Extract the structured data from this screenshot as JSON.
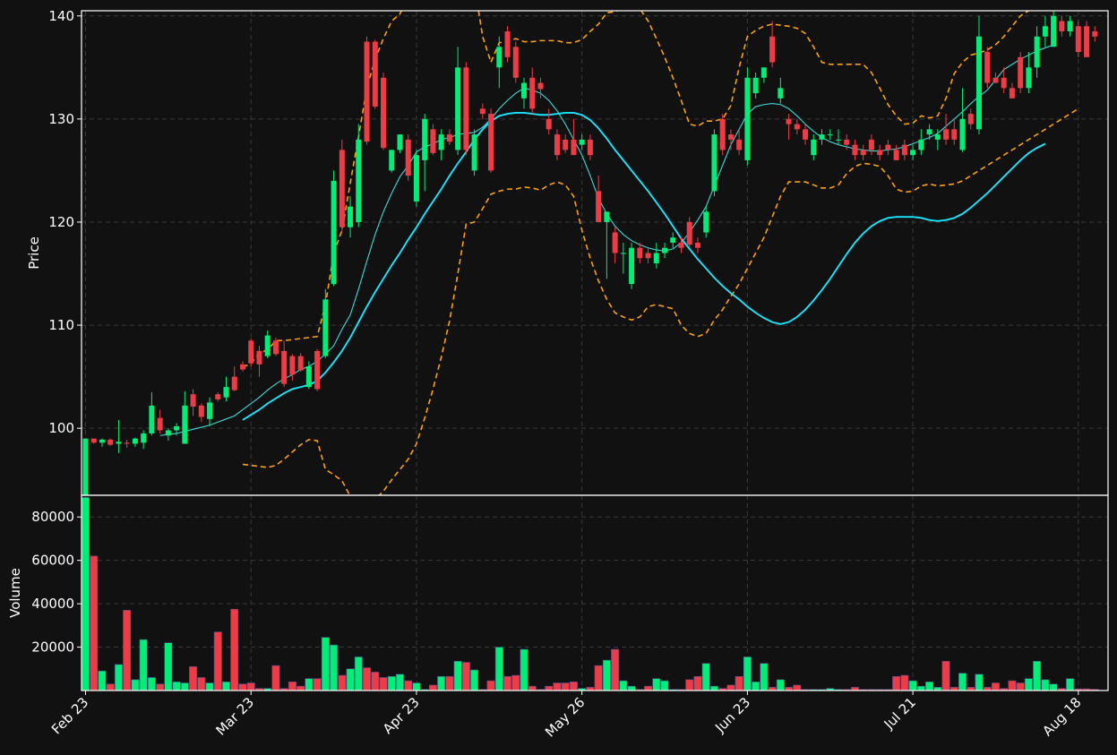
{
  "chart_data": {
    "type": "candlestick",
    "colors": {
      "background": "#111111",
      "up": "#00ee77",
      "down": "#ee3c46",
      "mav_short": "#40d8d8",
      "mav_long": "#18e6ff",
      "bands": "#ffa010",
      "grid": "#3a3a3a",
      "frame": "#ffffff"
    },
    "price_panel": {
      "ylabel": "Price",
      "ylim": [
        93.5,
        140.5
      ],
      "yticks": [
        100,
        110,
        120,
        130,
        140
      ]
    },
    "volume_panel": {
      "ylabel": "Volume",
      "ylim": [
        0,
        90000
      ],
      "yticks": [
        20000,
        40000,
        60000,
        80000
      ]
    },
    "x_ticks": [
      {
        "index": 0,
        "label": "Feb 23"
      },
      {
        "index": 20,
        "label": "Mar 23"
      },
      {
        "index": 40,
        "label": "Apr 23"
      },
      {
        "index": 60,
        "label": "May 26"
      },
      {
        "index": 80,
        "label": "Jun 23"
      },
      {
        "index": 100,
        "label": "Jul 21"
      },
      {
        "index": 120,
        "label": "Aug 18"
      }
    ],
    "candles": [
      [
        93.5,
        99,
        93.5,
        99,
        89000
      ],
      [
        99,
        99,
        98.5,
        98.6,
        62000
      ],
      [
        98.6,
        99,
        98.2,
        98.9,
        9000
      ],
      [
        98.9,
        99,
        98.3,
        98.4,
        3000
      ],
      [
        98.5,
        100.8,
        97.6,
        98.7,
        12000
      ],
      [
        98.6,
        98.9,
        98.1,
        98.5,
        37000
      ],
      [
        98.5,
        99.1,
        98.2,
        99.0,
        5000
      ],
      [
        98.6,
        99.8,
        98.0,
        99.5,
        23500
      ],
      [
        99.5,
        103.5,
        99.3,
        102.2,
        6000
      ],
      [
        101.0,
        101.8,
        99.5,
        99.8,
        3000
      ],
      [
        99.3,
        100.0,
        98.8,
        99.8,
        22000
      ],
      [
        99.8,
        100.5,
        99.3,
        100.2,
        4000
      ],
      [
        98.5,
        103.6,
        98.5,
        102.2,
        3500
      ],
      [
        103.3,
        103.8,
        101.2,
        102.1,
        11000
      ],
      [
        102.2,
        102.4,
        100.6,
        101.1,
        6000
      ],
      [
        100.9,
        103.0,
        100.2,
        102.5,
        3500
      ],
      [
        103.3,
        103.5,
        102.6,
        102.8,
        27000
      ],
      [
        103.0,
        105.0,
        102.6,
        104.0,
        4000
      ],
      [
        105.0,
        106.0,
        103.6,
        103.7,
        37500
      ],
      [
        106.2,
        106.5,
        105.5,
        105.7,
        3000
      ],
      [
        108.5,
        108.7,
        106.0,
        106.3,
        3500
      ],
      [
        107.5,
        108.0,
        105.0,
        106.2,
        1000
      ],
      [
        107.0,
        109.5,
        106.8,
        109.0,
        1000
      ],
      [
        108.5,
        108.8,
        107.0,
        107.2,
        11500
      ],
      [
        107.5,
        108.5,
        104.0,
        104.3,
        1000
      ],
      [
        107.0,
        107.2,
        104.6,
        105.2,
        4000
      ],
      [
        107.0,
        107.3,
        105.5,
        105.6,
        2000
      ],
      [
        104.0,
        106.5,
        103.8,
        106.0,
        5500
      ],
      [
        107.5,
        107.7,
        103.6,
        103.8,
        5500
      ],
      [
        107.0,
        113.5,
        106.8,
        112.5,
        24500
      ],
      [
        114.0,
        125.0,
        113.8,
        124.0,
        21000
      ],
      [
        127.0,
        128.0,
        119.0,
        119.5,
        7000
      ],
      [
        119.5,
        122.5,
        118.5,
        121.5,
        10000
      ],
      [
        120.0,
        129.5,
        119.5,
        128.0,
        15500
      ],
      [
        137.5,
        138.0,
        127.5,
        127.8,
        10500
      ],
      [
        137.5,
        137.7,
        131.0,
        131.2,
        8500
      ],
      [
        134.0,
        134.5,
        127.0,
        127.2,
        6000
      ],
      [
        125.0,
        127.0,
        124.8,
        127.0,
        6500
      ],
      [
        127.0,
        128.0,
        126.7,
        128.5,
        7500
      ],
      [
        128.0,
        128.5,
        124.0,
        124.5,
        4500
      ],
      [
        122.0,
        127.0,
        121.5,
        126.5,
        3500
      ],
      [
        126.0,
        130.5,
        123.0,
        130.0,
        500
      ],
      [
        129.0,
        129.5,
        126.5,
        126.7,
        2500
      ],
      [
        127.0,
        129.0,
        126.0,
        128.5,
        6500
      ],
      [
        128.5,
        129.0,
        127.5,
        127.8,
        6500
      ],
      [
        127.0,
        137.0,
        126.5,
        135.0,
        13500
      ],
      [
        135.0,
        135.5,
        126.5,
        127.0,
        13000
      ],
      [
        125.0,
        129.0,
        124.5,
        128.5,
        9500
      ],
      [
        131.0,
        131.5,
        130.0,
        130.5,
        500
      ],
      [
        130.5,
        131.0,
        124.8,
        125.0,
        4500
      ],
      [
        135.0,
        138.0,
        133.0,
        137.0,
        20000
      ],
      [
        138.5,
        139.0,
        135.5,
        136.0,
        6500
      ],
      [
        137.0,
        137.5,
        133.5,
        134.0,
        7000
      ],
      [
        132.0,
        134.0,
        131.0,
        133.5,
        19000
      ],
      [
        134.0,
        135.0,
        130.5,
        131.0,
        2000
      ],
      [
        133.5,
        134.0,
        132.0,
        132.9,
        500
      ],
      [
        130.0,
        131.0,
        128.5,
        129.0,
        2000
      ],
      [
        128.5,
        129.0,
        126.0,
        126.5,
        3500
      ],
      [
        128.0,
        128.5,
        126.7,
        127.0,
        3500
      ],
      [
        128.0,
        130.0,
        126.5,
        126.5,
        4000
      ],
      [
        127.5,
        128.5,
        127.0,
        128.0,
        1000
      ],
      [
        128.0,
        128.5,
        126.0,
        126.5,
        1500
      ],
      [
        123.0,
        124.5,
        120.0,
        120.0,
        11500
      ],
      [
        120.0,
        121.0,
        114.5,
        121.0,
        14000
      ],
      [
        119.0,
        119.5,
        116.0,
        117.0,
        19000
      ],
      [
        117.0,
        118.0,
        115.0,
        117.0,
        4500
      ],
      [
        114.0,
        118.0,
        113.5,
        117.5,
        2000
      ],
      [
        117.5,
        118.0,
        116.0,
        116.5,
        500
      ],
      [
        117.0,
        117.5,
        116.0,
        116.5,
        2000
      ],
      [
        116.0,
        118.0,
        115.5,
        117.0,
        5500
      ],
      [
        117.0,
        118.0,
        116.5,
        117.5,
        4500
      ],
      [
        118.0,
        119.0,
        117.5,
        118.5,
        500
      ],
      [
        118.0,
        118.5,
        117.0,
        117.5,
        500
      ],
      [
        120.0,
        120.5,
        117.5,
        117.8,
        5000
      ],
      [
        118.0,
        118.5,
        117.0,
        117.5,
        6500
      ],
      [
        119.0,
        121.5,
        118.5,
        121.0,
        12500
      ],
      [
        123.0,
        129.0,
        122.5,
        128.5,
        2000
      ],
      [
        130.0,
        130.5,
        126.5,
        127.0,
        1000
      ],
      [
        128.5,
        129.0,
        127.0,
        128.0,
        2500
      ],
      [
        128.0,
        129.0,
        126.5,
        127.0,
        6500
      ],
      [
        126.0,
        135.0,
        125.5,
        134.0,
        15500
      ],
      [
        132.5,
        134.5,
        132.0,
        134.0,
        4000
      ],
      [
        134.0,
        135.0,
        133.5,
        135.0,
        12500
      ],
      [
        138.0,
        139.5,
        135.0,
        135.5,
        1500
      ],
      [
        132.0,
        134.0,
        131.5,
        133.0,
        5000
      ],
      [
        130.0,
        130.5,
        128.0,
        129.5,
        1500
      ],
      [
        129.5,
        130.0,
        128.5,
        129.0,
        2500
      ],
      [
        129.0,
        129.5,
        127.5,
        128.0,
        500
      ],
      [
        126.5,
        128.5,
        126.0,
        128.0,
        500
      ],
      [
        128.0,
        129.0,
        127.5,
        128.5,
        500
      ],
      [
        128.5,
        129.0,
        128.0,
        128.5,
        1000
      ],
      [
        128.0,
        129.0,
        127.5,
        128.0,
        500
      ],
      [
        128.0,
        128.5,
        127.0,
        127.5,
        500
      ],
      [
        127.5,
        128.0,
        126.0,
        126.5,
        1500
      ],
      [
        127.0,
        127.5,
        126.0,
        126.5,
        500
      ],
      [
        128.0,
        128.5,
        126.5,
        127.0,
        500
      ],
      [
        127.0,
        127.5,
        126.0,
        126.5,
        500
      ],
      [
        127.5,
        128.0,
        126.5,
        127.0,
        500
      ],
      [
        127.0,
        127.5,
        126.0,
        126.0,
        6500
      ],
      [
        127.5,
        128.0,
        126.0,
        126.5,
        7000
      ],
      [
        126.5,
        127.5,
        126.0,
        127.0,
        4500
      ],
      [
        127.0,
        129.0,
        126.5,
        128.0,
        2000
      ],
      [
        128.5,
        129.5,
        128.0,
        129.0,
        4000
      ],
      [
        128.0,
        129.0,
        127.0,
        128.5,
        1500
      ],
      [
        129.0,
        130.5,
        127.5,
        128.0,
        13500
      ],
      [
        129.0,
        130.0,
        127.5,
        128.0,
        1500
      ],
      [
        127.0,
        133.0,
        126.8,
        130.0,
        8000
      ],
      [
        130.5,
        131.0,
        129.0,
        129.5,
        1500
      ],
      [
        129.0,
        140.0,
        128.5,
        138.0,
        7500
      ],
      [
        136.5,
        137.0,
        133.0,
        133.5,
        1500
      ],
      [
        134.0,
        134.5,
        133.5,
        133.5,
        3500
      ],
      [
        134.0,
        135.0,
        132.5,
        133.0,
        1000
      ],
      [
        133.0,
        133.5,
        132.0,
        132.0,
        4500
      ],
      [
        136.0,
        136.5,
        132.5,
        133.0,
        3500
      ],
      [
        133.0,
        136.5,
        132.5,
        135.0,
        5500
      ],
      [
        135.0,
        139.0,
        134.0,
        138.0,
        13500
      ],
      [
        138.0,
        140.0,
        137.0,
        139.0,
        5000
      ],
      [
        137.0,
        140.5,
        137.0,
        140.0,
        3000
      ],
      [
        139.5,
        140.0,
        138.0,
        138.5,
        1000
      ],
      [
        138.5,
        140.0,
        138.0,
        139.5,
        5500
      ],
      [
        139.0,
        139.5,
        136.0,
        136.5,
        800
      ],
      [
        139.0,
        139.5,
        136.0,
        136.0,
        800
      ],
      [
        138.5,
        139.0,
        137.5,
        138.0,
        600
      ]
    ],
    "mav_short": [
      null,
      null,
      null,
      null,
      null,
      null,
      null,
      null,
      null,
      99.3,
      99.4,
      99.5,
      99.7,
      99.9,
      100.1,
      100.3,
      100.6,
      100.9,
      101.2,
      101.8,
      102.4,
      103.0,
      103.7,
      104.3,
      104.8,
      105.2,
      105.7,
      106.0,
      106.5,
      107.2,
      108.0,
      109.6,
      111.0,
      113.5,
      116.2,
      118.8,
      121.0,
      122.8,
      124.4,
      125.5,
      126.8,
      127.3,
      127.6,
      128.0,
      128.2,
      128.5,
      128.6,
      128.7,
      129.2,
      130.0,
      131.0,
      131.8,
      132.5,
      133.0,
      132.8,
      132.5,
      131.8,
      130.8,
      129.5,
      128.0,
      126.5,
      124.5,
      122.3,
      120.8,
      119.6,
      118.8,
      118.2,
      117.8,
      117.5,
      117.3,
      117.2,
      117.4,
      118.0,
      119.0,
      120.2,
      121.5,
      123.5,
      125.5,
      127.5,
      129.0,
      130.5,
      131.2,
      131.4,
      131.5,
      131.4,
      131.0,
      130.3,
      129.5,
      128.8,
      128.2,
      127.8,
      127.5,
      127.3,
      127.1,
      127.0,
      126.9,
      126.9,
      127.0,
      127.1,
      127.3,
      127.6,
      127.9,
      128.2,
      128.6,
      129.3,
      130.0,
      130.7,
      131.5,
      132.2,
      132.8,
      133.8,
      134.8,
      135.3,
      135.8,
      136.2,
      136.6,
      136.9,
      137.2
    ],
    "mav_long": [
      null,
      null,
      null,
      null,
      null,
      null,
      null,
      null,
      null,
      null,
      null,
      null,
      null,
      null,
      null,
      null,
      null,
      null,
      null,
      100.8,
      101.3,
      101.8,
      102.4,
      102.9,
      103.4,
      103.8,
      104.0,
      104.2,
      104.6,
      105.4,
      106.4,
      107.5,
      108.8,
      110.3,
      111.8,
      113.2,
      114.5,
      115.8,
      117.0,
      118.3,
      119.5,
      120.8,
      122.0,
      123.2,
      124.5,
      125.7,
      126.8,
      128.0,
      129.0,
      129.8,
      130.3,
      130.5,
      130.6,
      130.6,
      130.5,
      130.4,
      130.4,
      130.5,
      130.6,
      130.6,
      130.4,
      129.9,
      129.1,
      128.1,
      127.0,
      126.0,
      125.0,
      124.0,
      123.0,
      121.9,
      120.8,
      119.6,
      118.4,
      117.4,
      116.4,
      115.5,
      114.6,
      113.8,
      113.1,
      112.5,
      111.8,
      111.2,
      110.7,
      110.3,
      110.1,
      110.3,
      110.8,
      111.5,
      112.4,
      113.4,
      114.5,
      115.7,
      116.9,
      118.0,
      118.9,
      119.6,
      120.1,
      120.4,
      120.5,
      120.5,
      120.5,
      120.4,
      120.2,
      120.1,
      120.2,
      120.4,
      120.8,
      121.4,
      122.1,
      122.8,
      123.6,
      124.4,
      125.2,
      126.0,
      126.7,
      127.2,
      127.6
    ],
    "bands_upper": [
      null,
      null,
      null,
      null,
      null,
      null,
      null,
      null,
      null,
      null,
      null,
      null,
      null,
      null,
      null,
      null,
      null,
      null,
      null,
      105.9,
      106.3,
      107.3,
      107.6,
      108.5,
      108.5,
      108.6,
      108.7,
      108.8,
      108.9,
      112.0,
      117.0,
      119.2,
      123.8,
      128.3,
      133.0,
      135.8,
      137.8,
      139.5,
      140.2,
      141.8,
      143.3,
      145.5,
      146.5,
      147.0,
      146.8,
      146.8,
      146.0,
      143.0,
      138.0,
      135.5,
      137.4,
      137.5,
      137.8,
      137.5,
      137.5,
      137.6,
      137.6,
      137.6,
      137.4,
      137.4,
      137.7,
      138.5,
      139.2,
      140.3,
      140.4,
      140.8,
      140.5,
      140.7,
      139.5,
      137.8,
      136.0,
      134.0,
      131.8,
      129.5,
      129.3,
      129.8,
      129.8,
      130.0,
      131.3,
      135.0,
      138.0,
      138.6,
      139.0,
      139.2,
      139.1,
      139.0,
      138.8,
      138.3,
      137.0,
      135.5,
      135.3,
      135.3,
      135.3,
      135.3,
      135.3,
      134.5,
      133.0,
      131.4,
      130.3,
      129.5,
      129.6,
      130.3,
      130.1,
      130.3,
      132.0,
      134.4,
      135.5,
      136.2,
      136.4,
      136.7,
      137.2,
      138.0,
      139.0,
      140.0,
      140.5,
      141.0,
      141.5,
      142.0,
      142.5
    ],
    "bands_lower": [
      null,
      null,
      null,
      null,
      null,
      null,
      null,
      null,
      null,
      null,
      null,
      null,
      null,
      null,
      null,
      null,
      null,
      null,
      null,
      96.5,
      96.4,
      96.3,
      96.2,
      96.4,
      97.0,
      97.7,
      98.4,
      98.9,
      98.8,
      96.0,
      95.5,
      94.9,
      93.4,
      92.3,
      92.5,
      93.1,
      93.9,
      95.0,
      96.0,
      97.0,
      98.5,
      101.0,
      103.8,
      106.9,
      110.4,
      115.0,
      119.8,
      120.0,
      121.3,
      122.7,
      123.0,
      123.2,
      123.2,
      123.4,
      123.3,
      123.1,
      123.6,
      123.9,
      123.6,
      122.5,
      119.2,
      116.5,
      114.3,
      112.5,
      111.2,
      110.8,
      110.5,
      110.8,
      111.8,
      112.0,
      111.8,
      111.6,
      110.0,
      109.2,
      108.9,
      109.2,
      110.5,
      111.5,
      112.8,
      114.0,
      115.5,
      117.0,
      118.5,
      120.5,
      122.5,
      123.9,
      123.9,
      123.9,
      123.6,
      123.3,
      123.3,
      123.6,
      124.7,
      125.4,
      125.7,
      125.6,
      125.4,
      124.5,
      123.2,
      122.9,
      123.0,
      123.5,
      123.7,
      123.5,
      123.6,
      123.7,
      124.0,
      124.5,
      125.0,
      125.5,
      126.0,
      126.5,
      127.0,
      127.5,
      128.0,
      128.5,
      129.0,
      129.5,
      130.0,
      130.5,
      131.0
    ]
  }
}
